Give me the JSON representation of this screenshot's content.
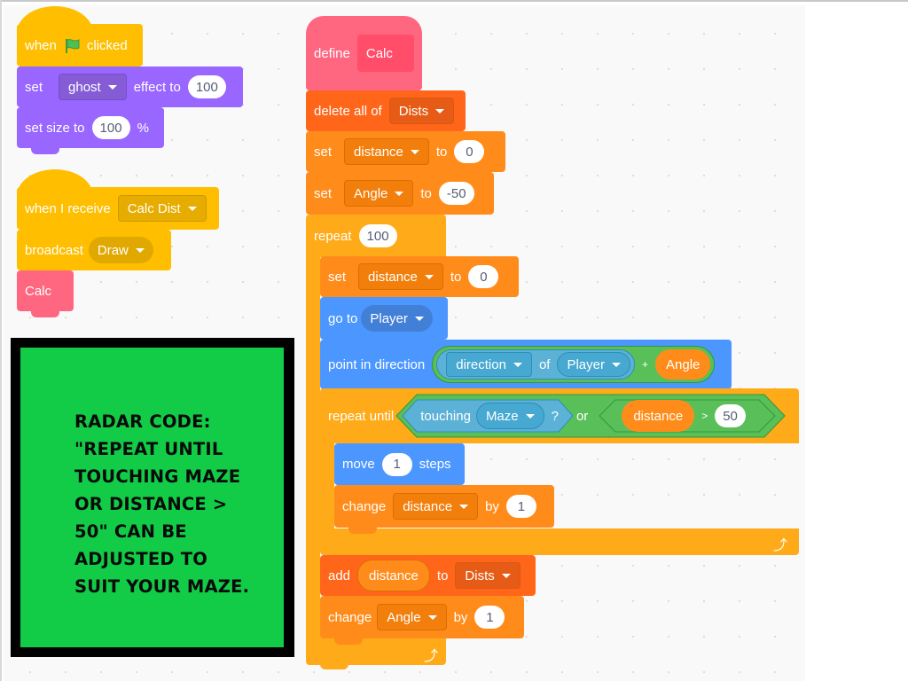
{
  "scripts": {
    "green_flag": {
      "hat": {
        "before": "when",
        "icon": "green-flag",
        "after": "clicked"
      },
      "set_effect": {
        "label": "set",
        "effect": "ghost",
        "mid": "effect to",
        "value": "100"
      },
      "set_size": {
        "label": "set size to",
        "value": "100",
        "unit": "%"
      }
    },
    "receive": {
      "hat": {
        "label": "when I receive",
        "message": "Calc Dist"
      },
      "broadcast": {
        "label": "broadcast",
        "message": "Draw"
      },
      "call": {
        "label": "Calc"
      }
    },
    "define_calc": {
      "define": {
        "label": "define",
        "name": "Calc"
      },
      "delete_all": {
        "label": "delete all of",
        "list": "Dists"
      },
      "set_distance": {
        "label": "set",
        "var": "distance",
        "mid": "to",
        "value": "0"
      },
      "set_angle": {
        "label": "set",
        "var": "Angle",
        "mid": "to",
        "value": "-50"
      },
      "repeat": {
        "label": "repeat",
        "value": "100"
      },
      "inner_set_distance": {
        "label": "set",
        "var": "distance",
        "mid": "to",
        "value": "0"
      },
      "go_to": {
        "label": "go to",
        "target": "Player"
      },
      "point": {
        "label": "point in direction",
        "attr": "direction",
        "of": "of",
        "sprite": "Player",
        "op": "+",
        "var": "Angle"
      },
      "repeat_until": {
        "label": "repeat until",
        "touching": "touching",
        "object": "Maze",
        "q": "?",
        "or": "or",
        "var": "distance",
        "gt": ">",
        "value": "50"
      },
      "move": {
        "label": "move",
        "value": "1",
        "unit": "steps"
      },
      "change_distance": {
        "label": "change",
        "var": "distance",
        "by": "by",
        "value": "1"
      },
      "add": {
        "label": "add",
        "var": "distance",
        "to": "to",
        "list": "Dists"
      },
      "change_angle": {
        "label": "change",
        "var": "Angle",
        "by": "by",
        "value": "1"
      }
    }
  },
  "note": {
    "lines": [
      "RADAR CODE:",
      "\"REPEAT UNTIL",
      "TOUCHING MAZE",
      "OR DISTANCE >",
      "50\" CAN BE",
      "ADJUSTED TO",
      "SUIT YOUR MAZE."
    ],
    "background": "#12cc47",
    "border": "#000000"
  },
  "colors": {
    "events": "#ffbf00",
    "looks": "#9966ff",
    "my_blocks": "#ff6680",
    "lists": "#ff661a",
    "variables": "#ff8c1a",
    "control": "#ffab19",
    "motion": "#4c97ff",
    "sensing": "#5cb1d6",
    "operators": "#59c059"
  }
}
